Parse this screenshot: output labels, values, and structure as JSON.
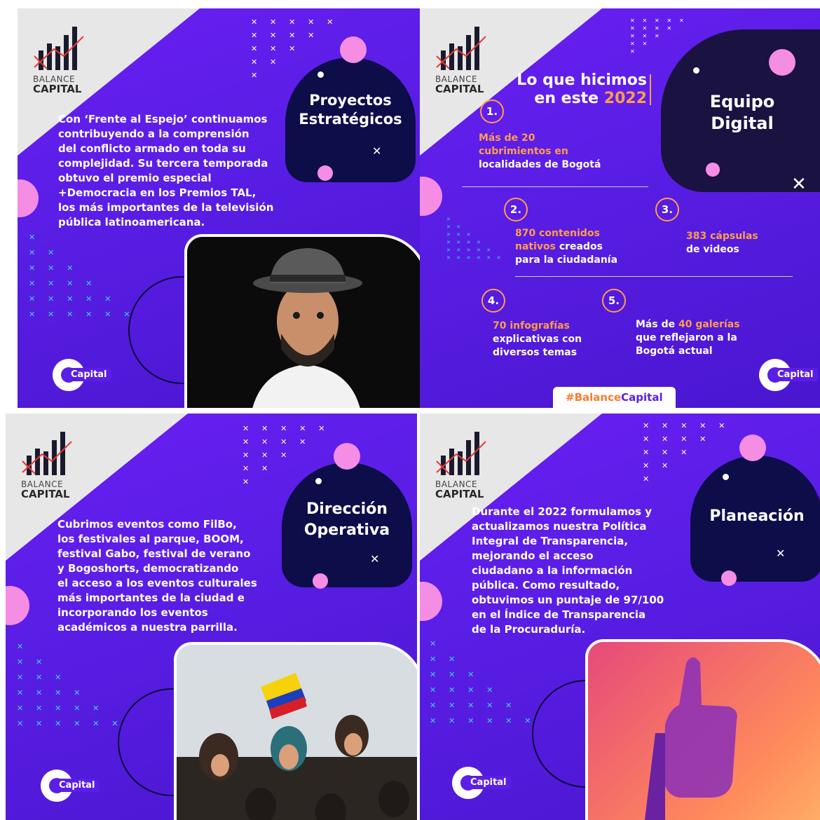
{
  "logo": {
    "line1": "BALANCE",
    "line2": "CAPITAL"
  },
  "capital_badge": "Capital",
  "panels": [
    {
      "title_lines": [
        "Proyectos",
        "Estratégicos"
      ],
      "body_lines": [
        "Con ‘Frente al Espejo’ continuamos",
        "contribuyendo a la comprensión",
        "del conflicto armado en toda su",
        "complejidad. Su tercera temporada",
        "obtuvo el premio especial",
        "+Democracia en los Premios TAL,",
        "los más importantes de la televisión",
        "pública latinoamericana."
      ],
      "photo": "man-with-hat-photo"
    },
    {
      "heading_line1": "Lo que hicimos",
      "heading_line2_a": "en este ",
      "heading_line2_b": "2022",
      "title_lines": [
        "Equipo",
        "Digital"
      ],
      "items": [
        {
          "n": "1.",
          "a": "Más de 20",
          "b": "cubrimientos en",
          "c": "localidades de Bogotá"
        },
        {
          "n": "2.",
          "a": "870 contenidos",
          "b1": "nativos",
          "b2": " creados",
          "c": "para la ciudadanía"
        },
        {
          "n": "3.",
          "a": "383 cápsulas",
          "b": "de videos"
        },
        {
          "n": "4.",
          "a": "70 infografías",
          "b": "explicativas con",
          "c": "diversos temas"
        },
        {
          "n": "5.",
          "a1": "Más de ",
          "a2": "40 galerías",
          "b": "que reflejaron a la",
          "c": "Bogotá actual"
        }
      ],
      "hashtag_a": "#Balance",
      "hashtag_b": "Capital"
    },
    {
      "title_lines": [
        "Dirección",
        "Operativa"
      ],
      "body_lines": [
        "Cubrimos eventos como FilBo,",
        "los festivales al parque, BOOM,",
        "festival Gabo, festival de verano",
        "y Bogoshorts, democratizando",
        "el acceso a los eventos culturales",
        "más importantes de la ciudad e",
        "incorporando los eventos",
        "académicos a nuestra parrilla."
      ],
      "photo": "crowd-with-flag-photo"
    },
    {
      "title_lines": [
        "Planeación"
      ],
      "body_lines": [
        "Durante el 2022 formulamos y",
        "actualizamos nuestra Política",
        "Integral de Transparencia,",
        "mejorando el acceso",
        "ciudadano a la información",
        "pública. Como resultado,",
        "obtuvimos un puntaje de 97/100",
        "en el Índice de Transparencia",
        "de la Procuraduría."
      ],
      "photo": "thumbs-up-photo"
    }
  ],
  "colors": {
    "bg": "#5a1ee6",
    "navy": "#0d0d4a",
    "pink": "#f58de4",
    "cyan": "#3ed3f0",
    "orange": "#ff9d4a"
  }
}
